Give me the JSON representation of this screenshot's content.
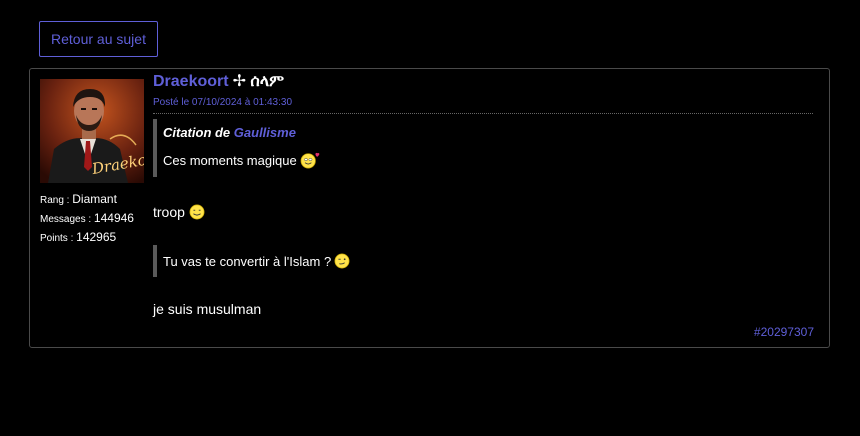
{
  "nav": {
    "back_label": "Retour au sujet"
  },
  "post": {
    "author": "Draekoort",
    "author_flair": "✢ ሰላም",
    "date": "Posté le 07/10/2024 à 01:43:30",
    "stats": [
      {
        "label": "Rang",
        "value": "Diamant"
      },
      {
        "label": "Messages",
        "value": "144946"
      },
      {
        "label": "Points",
        "value": "142965"
      }
    ],
    "stat_separator": " : ",
    "quote": {
      "prefix": "Citation de ",
      "author": "Gaullisme",
      "text": "Ces moments magique"
    },
    "line1": "troop",
    "quote2_text": "Tu vas te convertir à l'Islam ?",
    "line2": "je suis musulman",
    "post_id": "#20297307"
  },
  "avatar_signature": "Draekoort",
  "colors": {
    "background": "#000000",
    "accent": "#5f5fd8",
    "text": "#ffffff",
    "border": "#4a4a4a",
    "quote_bar": "#5a5a5a"
  },
  "icons": [
    "smiley-love-icon",
    "smiley-grin-icon",
    "smiley-wink-icon"
  ]
}
